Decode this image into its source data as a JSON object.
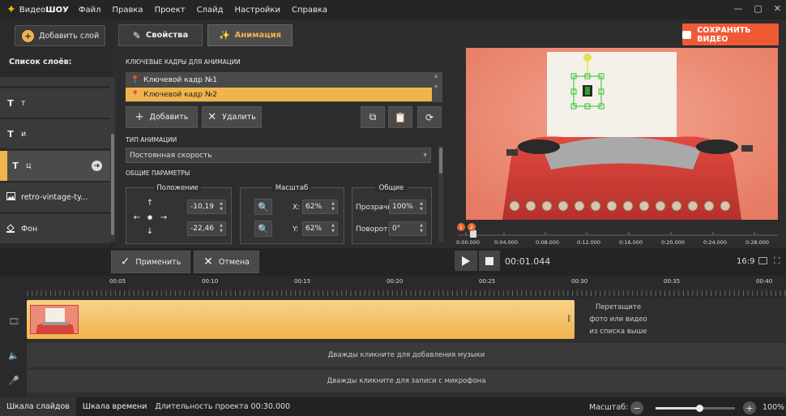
{
  "app": {
    "name_part1": "Видео",
    "name_part2": "ШОУ"
  },
  "menu": [
    "Файл",
    "Правка",
    "Проект",
    "Слайд",
    "Настройки",
    "Справка"
  ],
  "left": {
    "add_layer": "Добавить слой",
    "list_title": "Список слоёв:",
    "layers": [
      {
        "icon": "T",
        "label": "т"
      },
      {
        "icon": "T",
        "label": "и"
      },
      {
        "icon": "T",
        "label": "ц",
        "active": true
      },
      {
        "icon": "image-icon",
        "label": "retro-vintage-ty..."
      },
      {
        "icon": "fill-icon",
        "label": "Фон"
      }
    ]
  },
  "tabs": {
    "properties": "Свойства",
    "animation": "Анимация"
  },
  "animation": {
    "keyframes_title": "КЛЮЧЕВЫЕ КАДРЫ ДЛЯ АНИМАЦИИ",
    "keyframes": [
      "Ключевой кадр №1",
      "Ключевой кадр №2"
    ],
    "add": "Добавить",
    "delete": "Удалить",
    "type_title": "ТИП АНИМАЦИИ",
    "type_value": "Постоянная скорость",
    "params_title": "ОБЩИЕ ПАРАМЕТРЫ",
    "position_title": "Положение",
    "pos_x": "-10,19",
    "pos_y": "-22,46",
    "scale_title": "Масштаб",
    "scale_x_label": "X:",
    "scale_x": "62%",
    "scale_y_label": "Y:",
    "scale_y": "62%",
    "general_title": "Общие",
    "opacity_label": "Прозрачн",
    "opacity": "100%",
    "rotation_label": "Поворот:",
    "rotation": "0°"
  },
  "save_video": "СОХРАНИТЬ ВИДЕО",
  "scrub": {
    "markers": [
      "1",
      "2"
    ],
    "times": [
      "0:00.000",
      "0:04.000",
      "0:08.000",
      "0:12.000",
      "0:16.000",
      "0:20.000",
      "0:24.000",
      "0:28.000"
    ]
  },
  "controls": {
    "apply": "Применить",
    "cancel": "Отмена",
    "timecode": "00:01.044",
    "ratio": "16:9"
  },
  "ruler": [
    "00:05",
    "00:10",
    "00:15",
    "00:20",
    "00:25",
    "00:30",
    "00:35",
    "00:40"
  ],
  "tracks": {
    "drop_line1": "Перетащите",
    "drop_line2": "фото или видео",
    "drop_line3": "из списка выше",
    "music": "Дважды кликните для добавления музыки",
    "mic": "Дважды кликните для записи с микрофона"
  },
  "bottom": {
    "tab_slides": "Шкала слайдов",
    "tab_timeline": "Шкала времени",
    "duration": "Длительность проекта 00:30.000",
    "zoom_label": "Масштаб:",
    "zoom_value": "100%",
    "zoom_level": 0.55
  },
  "colors": {
    "accent": "#f0b44d",
    "save": "#ef5a35"
  }
}
